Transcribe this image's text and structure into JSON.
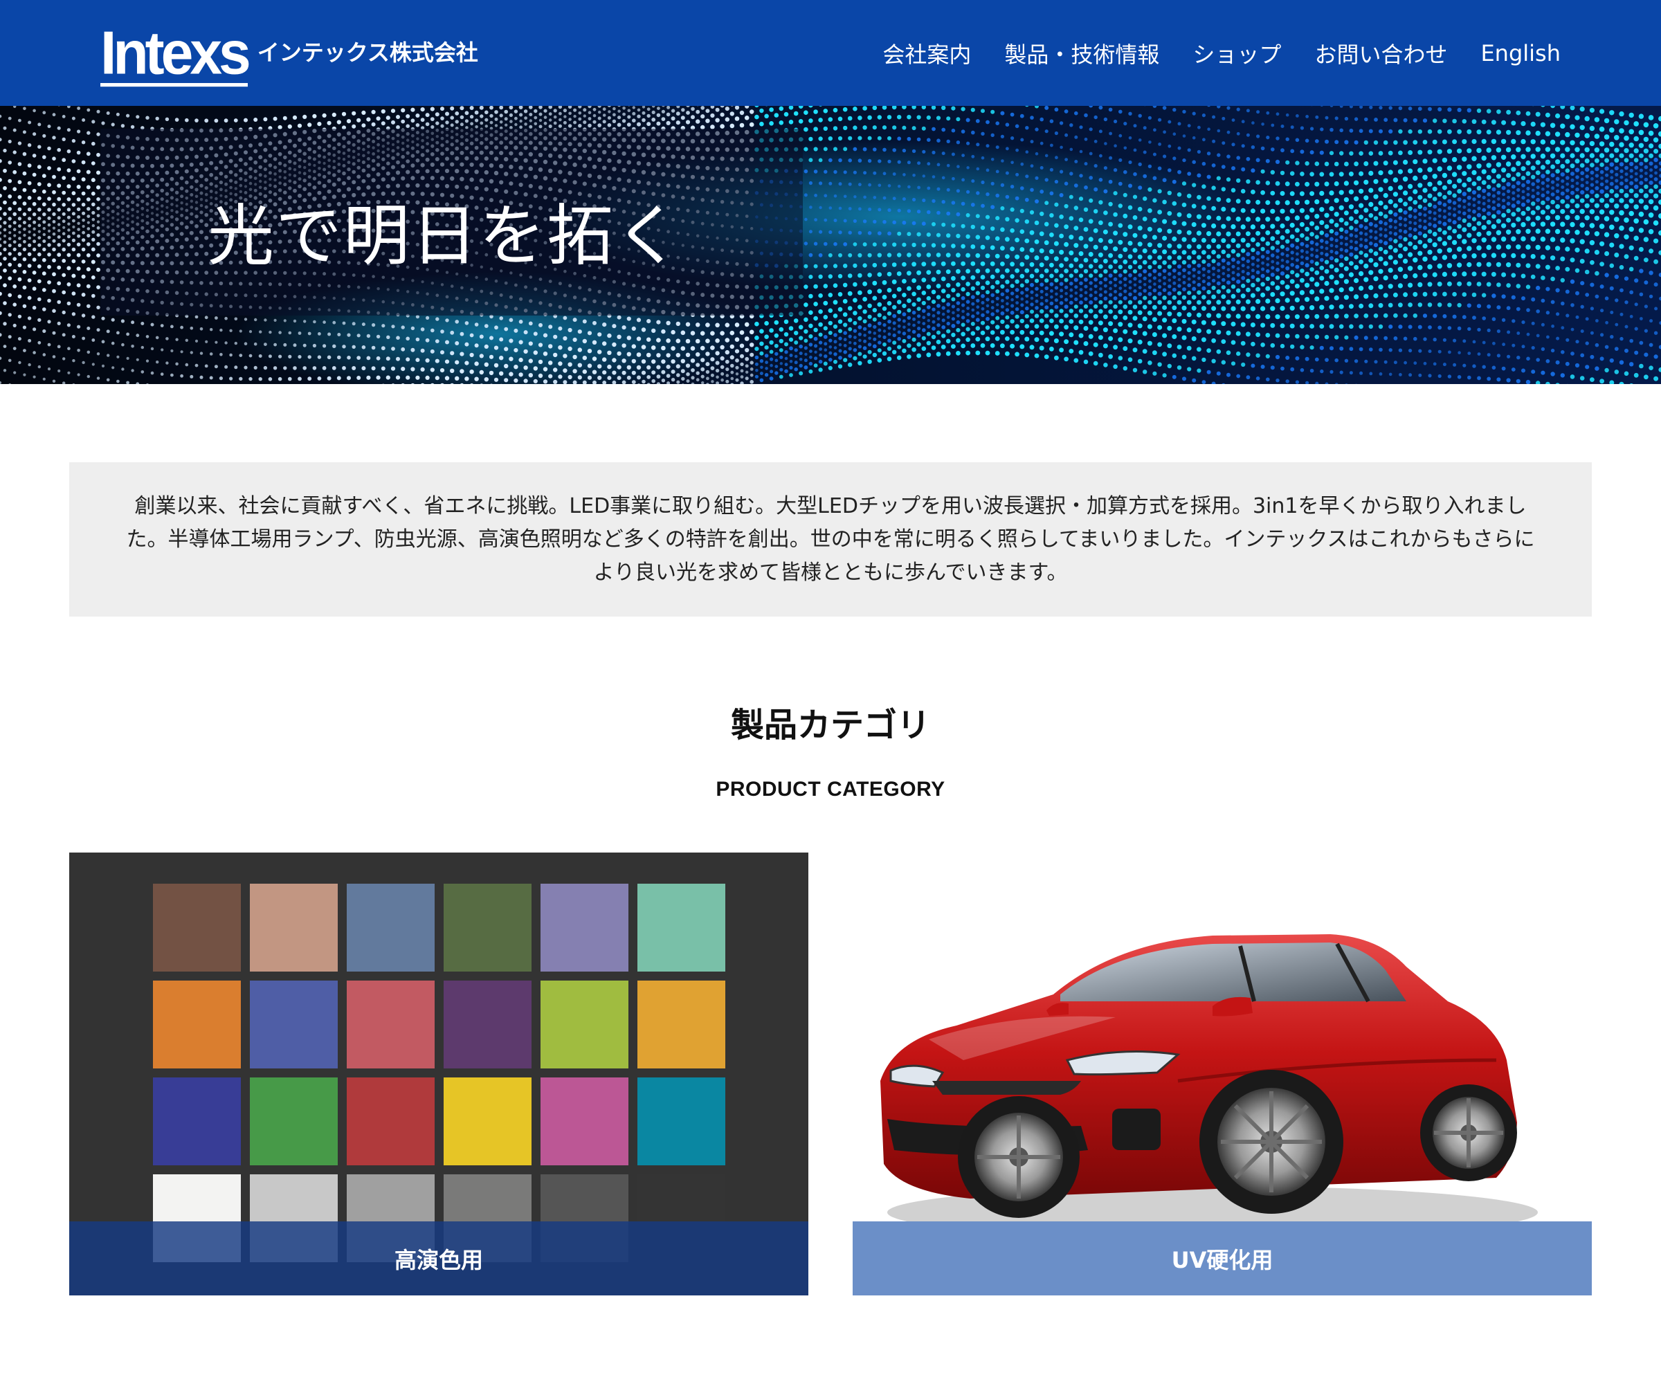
{
  "header": {
    "logo_mark": "Intexs",
    "logo_text": "インテックス株式会社",
    "nav": [
      {
        "label": "会社案内"
      },
      {
        "label": "製品・技術情報"
      },
      {
        "label": "ショップ"
      },
      {
        "label": "お問い合わせ"
      },
      {
        "label": "English"
      }
    ],
    "background_color": "#0a46a8"
  },
  "hero": {
    "title": "光で明日を拓く",
    "image": "dotted-wave-abstract"
  },
  "intro": {
    "text": "創業以来、社会に貢献すべく、省エネに挑戦。LED事業に取り組む。大型LEDチップを用い波長選択・加算方式を採用。3in1を早くから取り入れました。半導体工場用ランプ、防虫光源、高演色照明など多くの特許を創出。世の中を常に明るく照らしてまいりました。インテックスはこれからもさらにより良い光を求めて皆様とともに歩んでいきます。"
  },
  "product_section": {
    "title": "製品カテゴリ",
    "subtitle": "PRODUCT CATEGORY",
    "cards": [
      {
        "label": "高演色用",
        "image": "color-checker-chart",
        "swatches": [
          "#735244",
          "#c29682",
          "#627a9d",
          "#576c43",
          "#8580b1",
          "#79c0a8",
          "#da7e2f",
          "#4f5ea6",
          "#c25a62",
          "#5d3a6d",
          "#a0bc40",
          "#e0a232",
          "#383d96",
          "#479a48",
          "#b03a3c",
          "#e6c526",
          "#bc5795",
          "#0a87a2",
          "#f3f3f2",
          "#c8c8c8",
          "#a0a0a0",
          "#7a7a79",
          "#555555",
          "#343434"
        ]
      },
      {
        "label": "UV硬化用",
        "image": "red-sports-car"
      }
    ]
  }
}
